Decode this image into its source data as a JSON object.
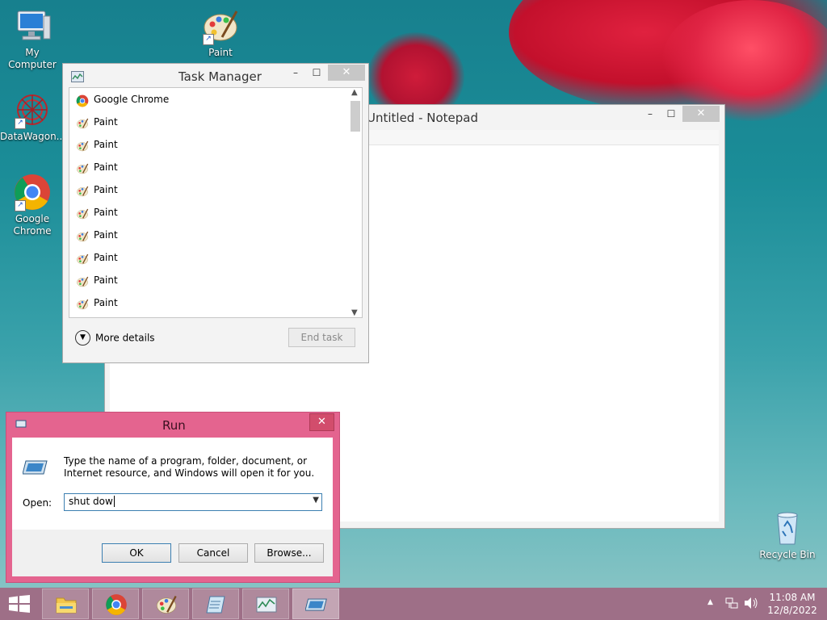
{
  "desktop": {
    "icons": [
      {
        "label": "My Computer",
        "icon": "computer-icon"
      },
      {
        "label": "Paint",
        "icon": "paint-icon"
      },
      {
        "label": "DataWagon...",
        "icon": "datawagon-icon"
      },
      {
        "label": "Google Chrome",
        "icon": "chrome-icon"
      },
      {
        "label": "Recycle Bin",
        "icon": "recycle-bin-icon"
      }
    ]
  },
  "notepad": {
    "title": "Untitled - Notepad",
    "controls": {
      "minimize": "–",
      "maximize": "☐",
      "close": "✕"
    }
  },
  "task_manager": {
    "title": "Task Manager",
    "controls": {
      "minimize": "–",
      "maximize": "☐",
      "close": "✕"
    },
    "processes": [
      {
        "name": "Google Chrome",
        "icon": "chrome-icon"
      },
      {
        "name": "Paint",
        "icon": "paint-icon"
      },
      {
        "name": "Paint",
        "icon": "paint-icon"
      },
      {
        "name": "Paint",
        "icon": "paint-icon"
      },
      {
        "name": "Paint",
        "icon": "paint-icon"
      },
      {
        "name": "Paint",
        "icon": "paint-icon"
      },
      {
        "name": "Paint",
        "icon": "paint-icon"
      },
      {
        "name": "Paint",
        "icon": "paint-icon"
      },
      {
        "name": "Paint",
        "icon": "paint-icon"
      },
      {
        "name": "Paint",
        "icon": "paint-icon"
      }
    ],
    "more_details": "More details",
    "end_task": "End task"
  },
  "run_dialog": {
    "title": "Run",
    "close": "✕",
    "description": "Type the name of a program, folder, document, or Internet resource, and Windows will open it for you.",
    "open_label": "Open:",
    "open_value": "shut dow",
    "ok": "OK",
    "cancel": "Cancel",
    "browse": "Browse..."
  },
  "taskbar": {
    "items": [
      "start-icon",
      "file-explorer-icon",
      "chrome-icon",
      "paint-icon",
      "notepad-icon",
      "task-manager-icon",
      "run-icon"
    ],
    "time": "11:08 AM",
    "date": "12/8/2022",
    "tray_icons": [
      "show-hidden-icons-icon",
      "network-icon",
      "volume-icon"
    ],
    "colors": {
      "taskbar": "#9e6f87",
      "run_frame": "#e4648f"
    }
  }
}
